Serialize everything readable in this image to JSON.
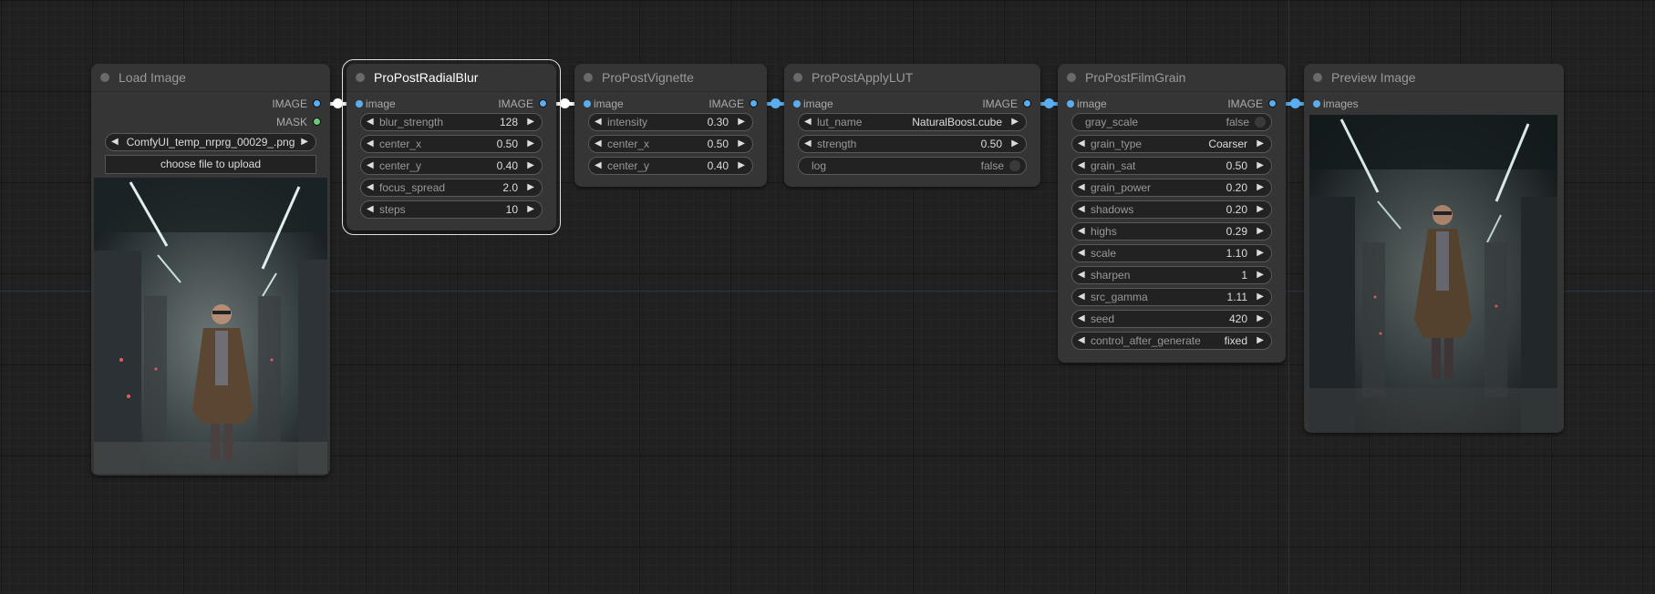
{
  "nodes": {
    "load_image": {
      "title": "Load Image",
      "outputs": [
        "IMAGE",
        "MASK"
      ],
      "image_combo": {
        "value": "ComfyUI_temp_nrprg_00029_.png"
      },
      "upload_label": "choose file to upload",
      "preview": "portrait of man in trench coat standing in server room corridor"
    },
    "radial_blur": {
      "title": "ProPostRadialBlur",
      "input": "image",
      "output": "IMAGE",
      "widgets": [
        {
          "name": "blur_strength",
          "value": "128"
        },
        {
          "name": "center_x",
          "value": "0.50"
        },
        {
          "name": "center_y",
          "value": "0.40"
        },
        {
          "name": "focus_spread",
          "value": "2.0"
        },
        {
          "name": "steps",
          "value": "10"
        }
      ]
    },
    "vignette": {
      "title": "ProPostVignette",
      "input": "image",
      "output": "IMAGE",
      "widgets": [
        {
          "name": "intensity",
          "value": "0.30"
        },
        {
          "name": "center_x",
          "value": "0.50"
        },
        {
          "name": "center_y",
          "value": "0.40"
        }
      ]
    },
    "apply_lut": {
      "title": "ProPostApplyLUT",
      "input": "image",
      "output": "IMAGE",
      "widgets": [
        {
          "name": "lut_name",
          "value": "NaturalBoost.cube"
        },
        {
          "name": "strength",
          "value": "0.50"
        },
        {
          "name": "log",
          "value": "false"
        }
      ]
    },
    "film_grain": {
      "title": "ProPostFilmGrain",
      "input": "image",
      "output": "IMAGE",
      "widgets": [
        {
          "name": "gray_scale",
          "value": "false"
        },
        {
          "name": "grain_type",
          "value": "Coarser"
        },
        {
          "name": "grain_sat",
          "value": "0.50"
        },
        {
          "name": "grain_power",
          "value": "0.20"
        },
        {
          "name": "shadows",
          "value": "0.20"
        },
        {
          "name": "highs",
          "value": "0.29"
        },
        {
          "name": "scale",
          "value": "1.10"
        },
        {
          "name": "sharpen",
          "value": "1"
        },
        {
          "name": "src_gamma",
          "value": "1.11"
        },
        {
          "name": "seed",
          "value": "420"
        },
        {
          "name": "control_after_generate",
          "value": "fixed"
        }
      ]
    },
    "preview_image": {
      "title": "Preview Image",
      "input": "images",
      "preview": "processed portrait of man in trench coat with film grain and vignette"
    }
  },
  "icons": {
    "arrow_left": "◀",
    "arrow_right": "▶"
  },
  "colors": {
    "link_image": "#5aaef0",
    "link_selected": "#ffffff",
    "mask_slot": "#6acb77"
  }
}
